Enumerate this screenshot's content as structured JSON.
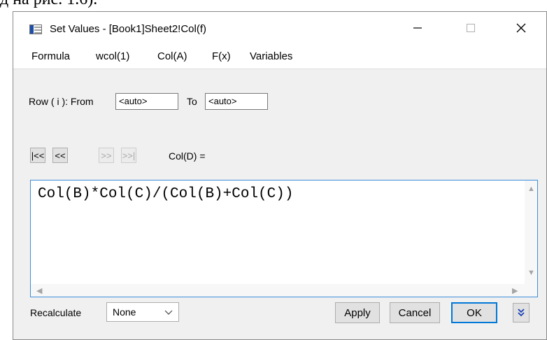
{
  "background_text": "д на рис. 1.6).",
  "window": {
    "title": "Set Values - [Book1]Sheet2!Col(f)",
    "controls": {
      "minimize": "—",
      "maximize": "☐",
      "close": "✕"
    }
  },
  "menu": [
    "Formula",
    "wcol(1)",
    "Col(A)",
    "F(x)",
    "Variables"
  ],
  "row_range": {
    "label": "Row ( i ):  From",
    "from_value": "<auto>",
    "to_label": "To",
    "to_value": "<auto>"
  },
  "navigation": {
    "first": "|<<",
    "prev": "<<",
    "next": ">>",
    "last": ">>|",
    "target_label": "Col(D) ="
  },
  "formula": "Col(B)*Col(C)/(Col(B)+Col(C))",
  "footer": {
    "recalculate_label": "Recalculate",
    "recalculate_value": "None",
    "apply": "Apply",
    "cancel": "Cancel",
    "ok": "OK"
  },
  "colors": {
    "accent": "#0078d7",
    "editor_border": "#3c8cd8",
    "dialog_bg": "#f0f0f0"
  }
}
